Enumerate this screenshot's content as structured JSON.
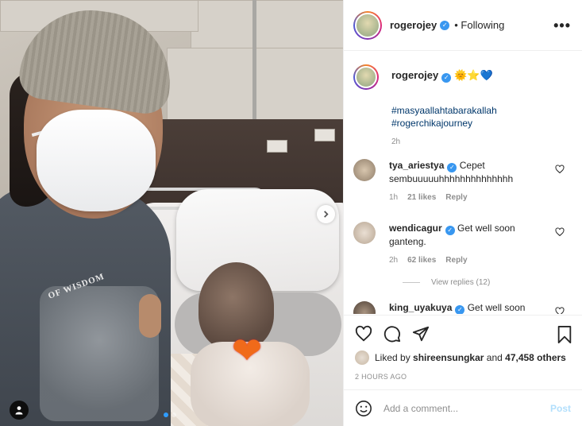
{
  "post": {
    "author": "rogerojey",
    "follow_status": "Following",
    "more_glyph": "•••",
    "photo": {
      "carousel_total": 2,
      "carousel_active": 1,
      "shirt_print_text": "OF WISDOM",
      "sticker": "❤"
    }
  },
  "caption": {
    "username": "rogerojey",
    "emojis": "🌞⭐💙",
    "hashtags": [
      "#masyaallahtabarakallah",
      "#rogerchikajourney"
    ],
    "time": "2h"
  },
  "comments": [
    {
      "username": "tya_ariestya",
      "text": "Cepet sembuuuuuhhhhhhhhhhhhhh",
      "time": "1h",
      "likes": "21 likes",
      "reply_label": "Reply",
      "avatar_color": "#c8b49c"
    },
    {
      "username": "wendicagur",
      "text": "Get well soon ganteng.",
      "time": "2h",
      "likes": "62 likes",
      "reply_label": "Reply",
      "avatar_color": "#d9c7b5",
      "view_replies": "View replies (12)"
    },
    {
      "username": "king_uyakuya",
      "text": "Get well soon",
      "avatar_color": "#8a7766"
    }
  ],
  "engagement": {
    "liked_by_prefix": "Liked by",
    "liked_by_user": "shireensungkar",
    "liked_by_and": "and",
    "liked_by_count": "47,458 others",
    "posted_time": "2 HOURS AGO"
  },
  "composer": {
    "placeholder": "Add a comment...",
    "post_label": "Post"
  },
  "colors": {
    "accent": "#3897f0",
    "link": "#00376b",
    "muted": "#8e8e8e",
    "post_disabled": "#b2dffc"
  }
}
